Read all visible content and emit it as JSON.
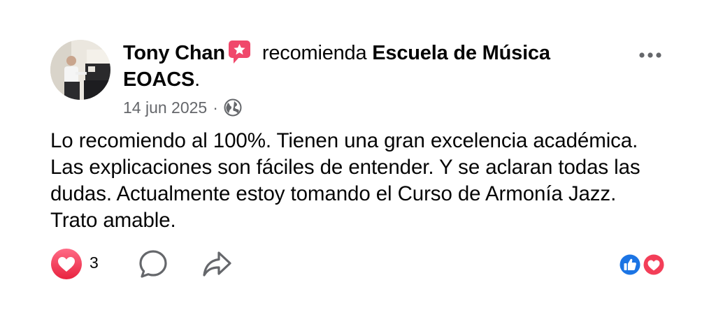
{
  "post": {
    "author": "Tony Chan",
    "verb": "recomienda",
    "page_name": "Escuela de Música EOACS",
    "page_suffix": ".",
    "date": "14 jun 2025",
    "separator": "·",
    "body": "Lo recomiendo al 100%. Tienen una gran excelencia académica. Las explicaciones son fáciles de entender. Y se aclaran todas las dudas. Actualmente estoy tomando el Curso de Armonía Jazz. Trato amable.",
    "reaction_count": "3"
  },
  "icons": {
    "badge": "star-badge-icon",
    "privacy": "globe-icon",
    "more": "more-dots-icon",
    "react": "heart-react-icon",
    "comment": "comment-icon",
    "share": "share-icon",
    "summary": [
      "like-icon",
      "love-icon"
    ]
  },
  "colors": {
    "text_primary": "#050505",
    "text_secondary": "#65676b",
    "badge_pink": "#f0486b",
    "like_blue": "#1b74e4",
    "love_red": "#f33e58"
  }
}
